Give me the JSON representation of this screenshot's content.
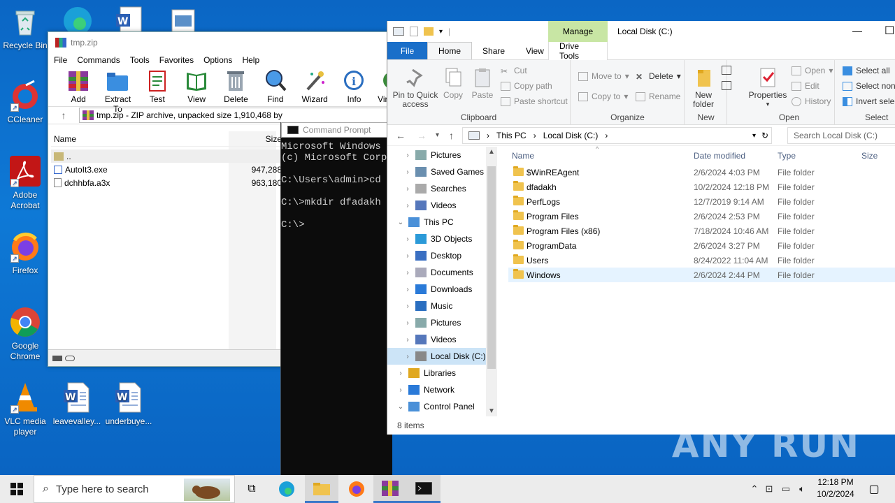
{
  "desktop": {
    "icons": [
      {
        "label": "Recycle Bin"
      },
      {
        "label": "CCleaner"
      },
      {
        "label": "Adobe Acrobat"
      },
      {
        "label": "Firefox"
      },
      {
        "label": "Google Chrome"
      },
      {
        "label": "VLC media player"
      },
      {
        "label": "leavevalley..."
      },
      {
        "label": "underbuye..."
      }
    ],
    "watermark": "ANY RUN"
  },
  "winrar": {
    "title": "tmp.zip",
    "menu": [
      "File",
      "Commands",
      "Tools",
      "Favorites",
      "Options",
      "Help"
    ],
    "toolbar": [
      "Add",
      "Extract To",
      "Test",
      "View",
      "Delete",
      "Find",
      "Wizard",
      "Info",
      "Vir"
    ],
    "path": "tmp.zip - ZIP archive, unpacked size 1,910,468 by",
    "columns": {
      "name": "Name",
      "size": "Size"
    },
    "rows": [
      {
        "name": "..",
        "size": ""
      },
      {
        "name": "AutoIt3.exe",
        "size": "947,288"
      },
      {
        "name": "dchhbfa.a3x",
        "size": "963,180"
      }
    ]
  },
  "cmd": {
    "title": "Command Prompt",
    "lines": "Microsoft Windows [\n(c) Microsoft Corpo\n\nC:\\Users\\admin>cd .\n\nC:\\>mkdir dfadakh\n\nC:\\>"
  },
  "explorer": {
    "title": "Local Disk (C:)",
    "manage": "Manage",
    "tabs": [
      "File",
      "Home",
      "Share",
      "View",
      "Drive Tools"
    ],
    "ribbon": {
      "clipboard": {
        "pin": "Pin to Quick access",
        "copy": "Copy",
        "paste": "Paste",
        "cut": "Cut",
        "copy_path": "Copy path",
        "paste_shortcut": "Paste shortcut",
        "label": "Clipboard"
      },
      "organize": {
        "move_to": "Move to",
        "copy_to": "Copy to",
        "delete": "Delete",
        "rename": "Rename",
        "label": "Organize"
      },
      "new": {
        "new_folder": "New folder",
        "label": "New"
      },
      "open": {
        "properties": "Properties",
        "open": "Open",
        "edit": "Edit",
        "history": "History",
        "label": "Open"
      },
      "select": {
        "select_all": "Select all",
        "select_none": "Select none",
        "invert": "Invert selec",
        "label": "Select"
      }
    },
    "breadcrumb": [
      "This PC",
      "Local Disk (C:)"
    ],
    "search_placeholder": "Search Local Disk (C:)",
    "tree": [
      {
        "label": "Pictures",
        "indent": 1
      },
      {
        "label": "Saved Games",
        "indent": 1
      },
      {
        "label": "Searches",
        "indent": 1
      },
      {
        "label": "Videos",
        "indent": 1
      },
      {
        "label": "This PC",
        "indent": 0
      },
      {
        "label": "3D Objects",
        "indent": 1
      },
      {
        "label": "Desktop",
        "indent": 1
      },
      {
        "label": "Documents",
        "indent": 1
      },
      {
        "label": "Downloads",
        "indent": 1
      },
      {
        "label": "Music",
        "indent": 1
      },
      {
        "label": "Pictures",
        "indent": 1
      },
      {
        "label": "Videos",
        "indent": 1
      },
      {
        "label": "Local Disk (C:)",
        "indent": 1
      },
      {
        "label": "Libraries",
        "indent": 0
      },
      {
        "label": "Network",
        "indent": 0
      },
      {
        "label": "Control Panel",
        "indent": 0
      }
    ],
    "columns": {
      "name": "Name",
      "date": "Date modified",
      "type": "Type",
      "size": "Size"
    },
    "files": [
      {
        "name": "$WinREAgent",
        "date": "2/6/2024 4:03 PM",
        "type": "File folder"
      },
      {
        "name": "dfadakh",
        "date": "10/2/2024 12:18 PM",
        "type": "File folder"
      },
      {
        "name": "PerfLogs",
        "date": "12/7/2019 9:14 AM",
        "type": "File folder"
      },
      {
        "name": "Program Files",
        "date": "2/6/2024 2:53 PM",
        "type": "File folder"
      },
      {
        "name": "Program Files (x86)",
        "date": "7/18/2024 10:46 AM",
        "type": "File folder"
      },
      {
        "name": "ProgramData",
        "date": "2/6/2024 3:27 PM",
        "type": "File folder"
      },
      {
        "name": "Users",
        "date": "8/24/2022 11:04 AM",
        "type": "File folder"
      },
      {
        "name": "Windows",
        "date": "2/6/2024 2:44 PM",
        "type": "File folder"
      }
    ],
    "status": "8 items"
  },
  "taskbar": {
    "search_placeholder": "Type here to search",
    "time": "12:18 PM",
    "date": "10/2/2024"
  }
}
